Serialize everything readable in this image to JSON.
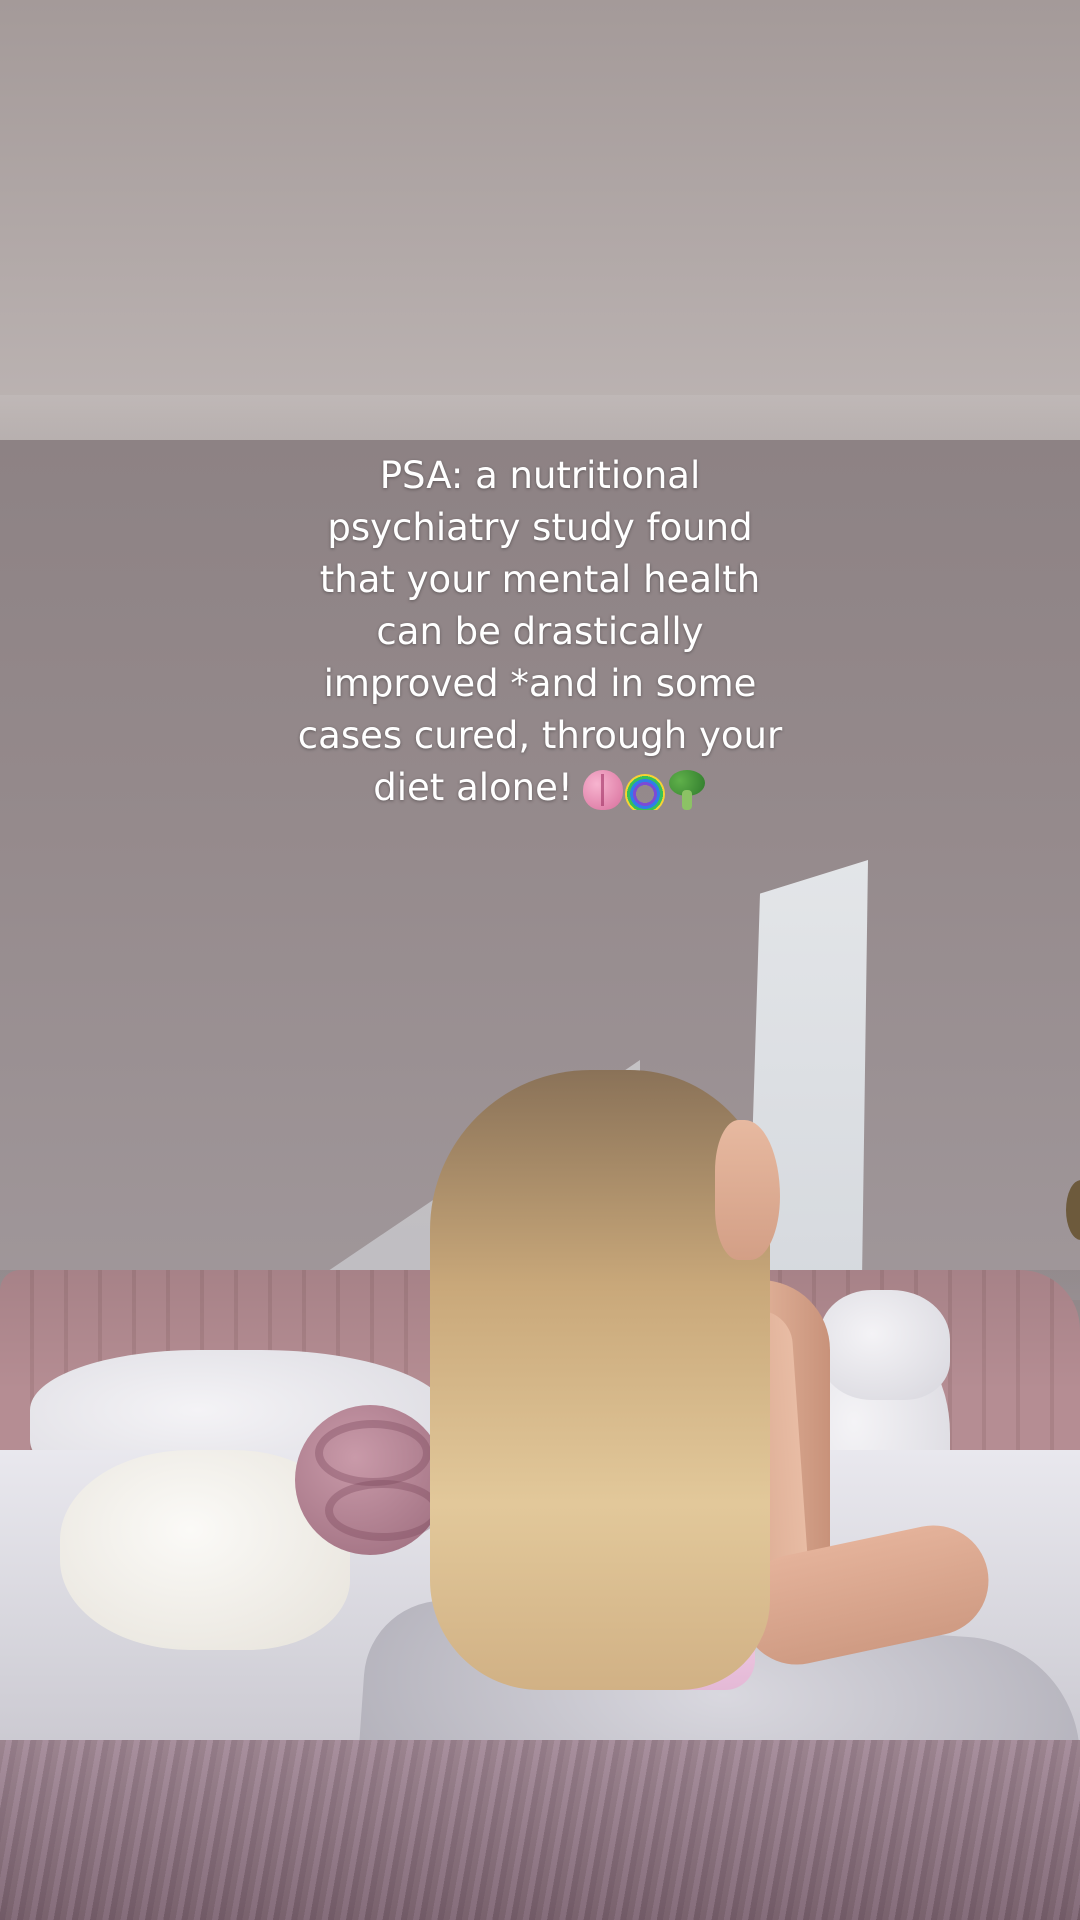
{
  "caption": {
    "lines": [
      "PSA: a nutritional",
      "psychiatry study found",
      "that your mental health",
      "can be drastically",
      "improved *and in some",
      "cases cured, through your",
      "diet alone!"
    ],
    "emojis": [
      "brain-emoji",
      "rainbow-emoji",
      "broccoli-emoji"
    ]
  }
}
